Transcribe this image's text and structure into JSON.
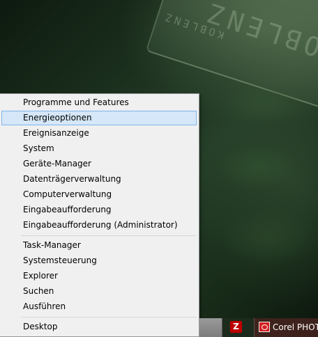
{
  "desktop": {
    "plate_text_large": "OBLENZ",
    "plate_text_small": "KOBLENZ"
  },
  "context_menu": {
    "items": [
      {
        "label": "Programme und Features"
      },
      {
        "label": "Energieoptionen",
        "selected": true
      },
      {
        "label": "Ereignisanzeige"
      },
      {
        "label": "System"
      },
      {
        "label": "Geräte-Manager"
      },
      {
        "label": "Datenträgerverwaltung"
      },
      {
        "label": "Computerverwaltung"
      },
      {
        "label": "Eingabeaufforderung"
      },
      {
        "label": "Eingabeaufforderung (Administrator)"
      },
      {
        "label": "Task-Manager"
      },
      {
        "label": "Systemsteuerung"
      },
      {
        "label": "Explorer"
      },
      {
        "label": "Suchen"
      },
      {
        "label": "Ausführen"
      },
      {
        "label": "Desktop"
      }
    ]
  },
  "taskbar": {
    "filezilla_icon": "filezilla-icon",
    "filezilla_glyph": "Z",
    "corel_icon": "corel-photo-icon",
    "corel_label": "Corel PHOTO"
  },
  "colors": {
    "menu_background": "#f0f0f0",
    "selection_background": "#d5e7f8",
    "selection_border": "#7eb4ea",
    "filezilla_red": "#bf0000"
  }
}
